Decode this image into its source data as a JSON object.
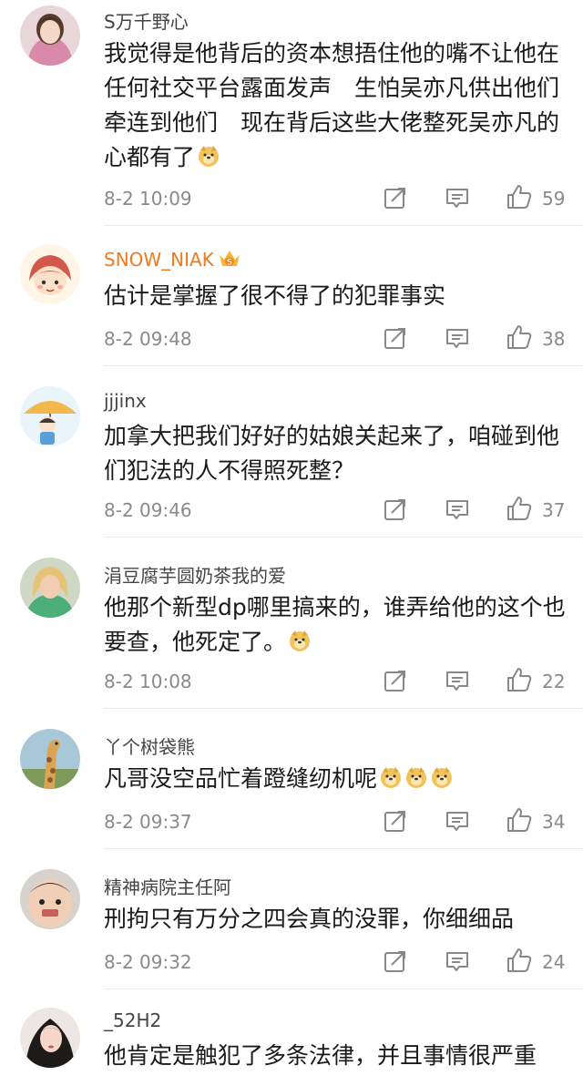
{
  "colors": {
    "background": "#ffffff",
    "username": "#444444",
    "vip_username": "#f07a1c",
    "meta": "#8a8a8a",
    "icon": "#888888"
  },
  "comments": [
    {
      "username": "S万千野心",
      "vip": false,
      "content": "我觉得是他背后的资本想捂住他的嘴不让他在任何社交平台露面发声　生怕吴亦凡供出他们牵连到他们　现在背后这些大佬整死吴亦凡的心都有了",
      "emoji_count": 1,
      "time": "8-2 10:09",
      "likes": "59",
      "avatar_icon": "avatar-girl-pink"
    },
    {
      "username": "SNOW_NIAK",
      "vip": true,
      "content": "估计是掌握了很不得了的犯罪事实",
      "emoji_count": 0,
      "time": "8-2 09:48",
      "likes": "38",
      "avatar_icon": "avatar-cartoon-girl"
    },
    {
      "username": "jjjinx",
      "vip": false,
      "content": "加拿大把我们好好的姑娘关起来了，咱碰到他们犯法的人不得照死整？",
      "emoji_count": 0,
      "time": "8-2 09:46",
      "likes": "37",
      "avatar_icon": "avatar-umbrella-kid"
    },
    {
      "username": "涓豆腐芋圆奶茶我的爱",
      "vip": false,
      "content": "他那个新型dp哪里搞来的，谁弄给他的这个也要查，他死定了。",
      "emoji_count": 1,
      "time": "8-2 10:08",
      "likes": "22",
      "avatar_icon": "avatar-blonde-woman"
    },
    {
      "username": "丫个树袋熊",
      "vip": false,
      "content": "凡哥没空品忙着蹬缝纫机呢",
      "emoji_count": 3,
      "time": "8-2 09:37",
      "likes": "34",
      "avatar_icon": "avatar-giraffe"
    },
    {
      "username": "精神病院主任阿",
      "vip": false,
      "content": "刑拘只有万分之四会真的没罪，你细细品",
      "emoji_count": 0,
      "time": "8-2 09:32",
      "likes": "24",
      "avatar_icon": "avatar-baby"
    },
    {
      "username": "_52H2",
      "vip": false,
      "content": "他肯定是触犯了多条法律，并且事情很严重",
      "emoji_count": 0,
      "time": "",
      "likes": "",
      "avatar_icon": "avatar-woman-dark-hair"
    }
  ]
}
